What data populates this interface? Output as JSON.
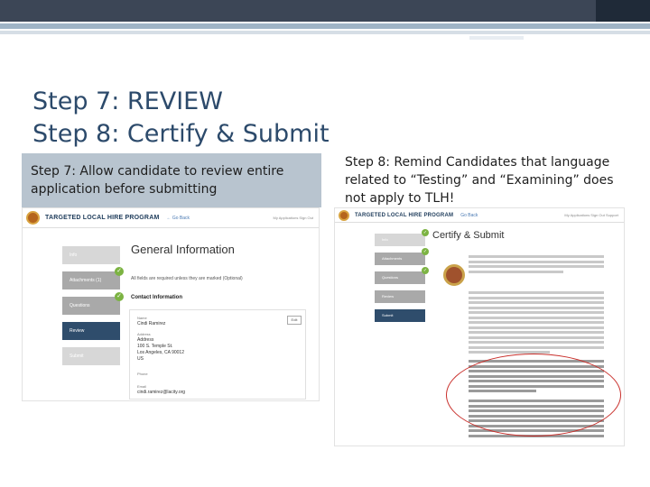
{
  "slide": {
    "title_line1": "Step 7: REVIEW",
    "title_line2": "Step 8: Certify & Submit",
    "left_bullet": "Step 7: Allow candidate to review entire application before submitting",
    "right_bullet": "Step 8: Remind Candidates that language related to “Testing” and “Examining” does not apply to TLH!"
  },
  "left_screenshot": {
    "program_name": "TARGETED LOCAL HIRE PROGRAM",
    "breadcrumb": "← Go Back",
    "header_right": "My Applications  Sign Out",
    "nav": [
      {
        "label": "Info",
        "state": "light",
        "checked": false
      },
      {
        "label": "Attachments (1)",
        "state": "done",
        "checked": true
      },
      {
        "label": "Questions",
        "state": "done",
        "checked": true
      },
      {
        "label": "Review",
        "state": "active",
        "checked": false
      },
      {
        "label": "Submit",
        "state": "light",
        "checked": false
      }
    ],
    "page_title": "General Information",
    "required_note": "All fields are required unless they are marked (Optional)",
    "section_title": "Contact Information",
    "fields": {
      "name_label": "Name",
      "name_value": "Cindi Ramirez",
      "address_label": "Address",
      "address_value": "Address\n100 S. Temple St.\nLos Angeles, CA 90012\nUS",
      "phone_label": "Phone",
      "email_label": "Email",
      "email_value": "cindi.ramirez@lacity.org"
    },
    "edit_label": "Edit"
  },
  "right_screenshot": {
    "program_name": "TARGETED LOCAL HIRE PROGRAM",
    "breadcrumb": "Go Back",
    "header_right": "My Applications  Sign Out  Support",
    "nav": [
      {
        "label": "Info",
        "state": "light",
        "checked": false
      },
      {
        "label": "Attachments",
        "state": "done",
        "checked": true
      },
      {
        "label": "Questions",
        "state": "done",
        "checked": true
      },
      {
        "label": "Review",
        "state": "done",
        "checked": false
      },
      {
        "label": "Submit",
        "state": "active",
        "checked": false
      }
    ],
    "page_title": "Certify & Submit"
  },
  "colors": {
    "title": "#2c4a6b",
    "nav_active": "#2f4d6c",
    "check": "#7cb342",
    "highlight_circle": "#c9302c"
  }
}
